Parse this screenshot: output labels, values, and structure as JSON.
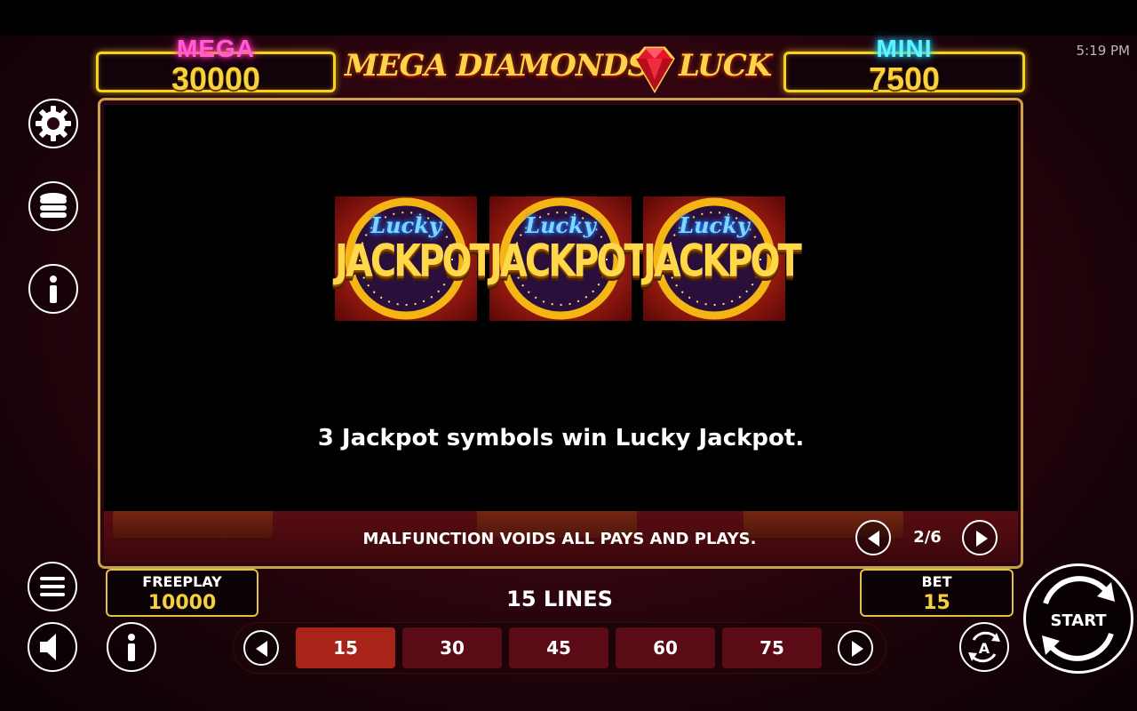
{
  "status_bar": {
    "time": "5:19 PM"
  },
  "jackpots": {
    "mega": {
      "name": "MEGA",
      "value": "30000",
      "color": "#ff5fd2"
    },
    "mini": {
      "name": "MINI",
      "value": "7500",
      "color": "#62f3ff"
    }
  },
  "logo": {
    "left_text": "MEGA DIAMONDS",
    "right_text": "LUCK",
    "gem_icon": "diamond-icon"
  },
  "sidebar": {
    "icons": [
      "gear-icon",
      "coins-stack-icon",
      "info-icon"
    ]
  },
  "info_page": {
    "symbols": [
      {
        "top_text": "Lucky",
        "main_text": "JACKPOT"
      },
      {
        "top_text": "Lucky",
        "main_text": "JACKPOT"
      },
      {
        "top_text": "Lucky",
        "main_text": "JACKPOT"
      }
    ],
    "description": "3 Jackpot symbols win Lucky Jackpot.",
    "disclaimer": "MALFUNCTION VOIDS ALL PAYS AND PLAYS.",
    "page_indicator": "2/6",
    "current_page": 2,
    "total_pages": 6
  },
  "bottom": {
    "freeplay": {
      "label": "FREEPLAY",
      "value": "10000"
    },
    "bet": {
      "label": "BET",
      "value": "15"
    },
    "lines_label": "15 LINES",
    "line_options": [
      "15",
      "30",
      "45",
      "60",
      "75"
    ],
    "selected_line": "15",
    "start_label": "START"
  },
  "colors": {
    "accent_gold": "#f7d21c",
    "panel_border": "#c9a24a",
    "active_line": "#a82418",
    "inactive_line": "#5a0b16"
  }
}
